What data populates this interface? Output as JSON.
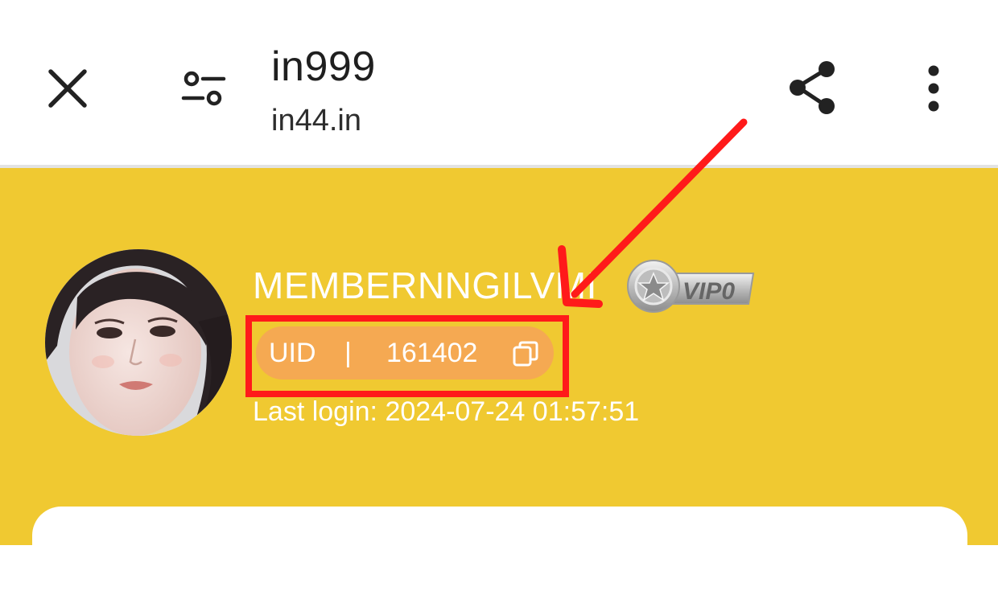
{
  "toolbar": {
    "title": "in999",
    "url": "in44.in",
    "close_icon": "close-icon",
    "tune_icon": "page-settings-icon",
    "share_icon": "share-icon",
    "more_icon": "more-vertical-icon"
  },
  "profile": {
    "username": "MEMBERNNGILVMI",
    "vip_level": "VIP0",
    "uid_label": "UID",
    "uid_separator": "|",
    "uid_value": "161402",
    "last_login": "Last login: 2024-07-24 01:57:51"
  },
  "colors": {
    "header_bg": "#f0c931",
    "uid_pill": "#f5a952",
    "annotation": "#ff1a1a"
  }
}
